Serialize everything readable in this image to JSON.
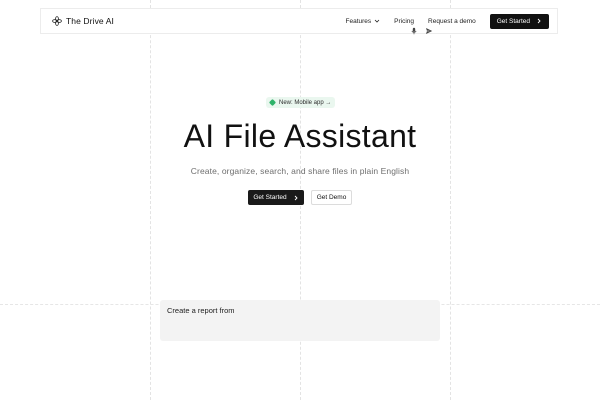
{
  "brand": {
    "name": "The Drive AI",
    "icon": "logo-flower-icon"
  },
  "nav": {
    "links": [
      {
        "label": "Features",
        "has_dropdown": true
      },
      {
        "label": "Pricing"
      },
      {
        "label": "Request a demo"
      }
    ],
    "cta_label": "Get Started"
  },
  "hero": {
    "badge": "New: Mobile app →",
    "title": "AI File Assistant",
    "subtitle": "Create, organize, search, and share files in plain English",
    "primary_label": "Get Started",
    "secondary_label": "Get Demo"
  },
  "prompt": {
    "text": "Create a report from",
    "icons": [
      "microphone-icon",
      "send-icon"
    ]
  },
  "colors": {
    "dark": "#111111",
    "badge_bg": "#eaf7ef",
    "badge_dot": "#2fb36a",
    "prompt_bg": "#f3f3f3"
  }
}
